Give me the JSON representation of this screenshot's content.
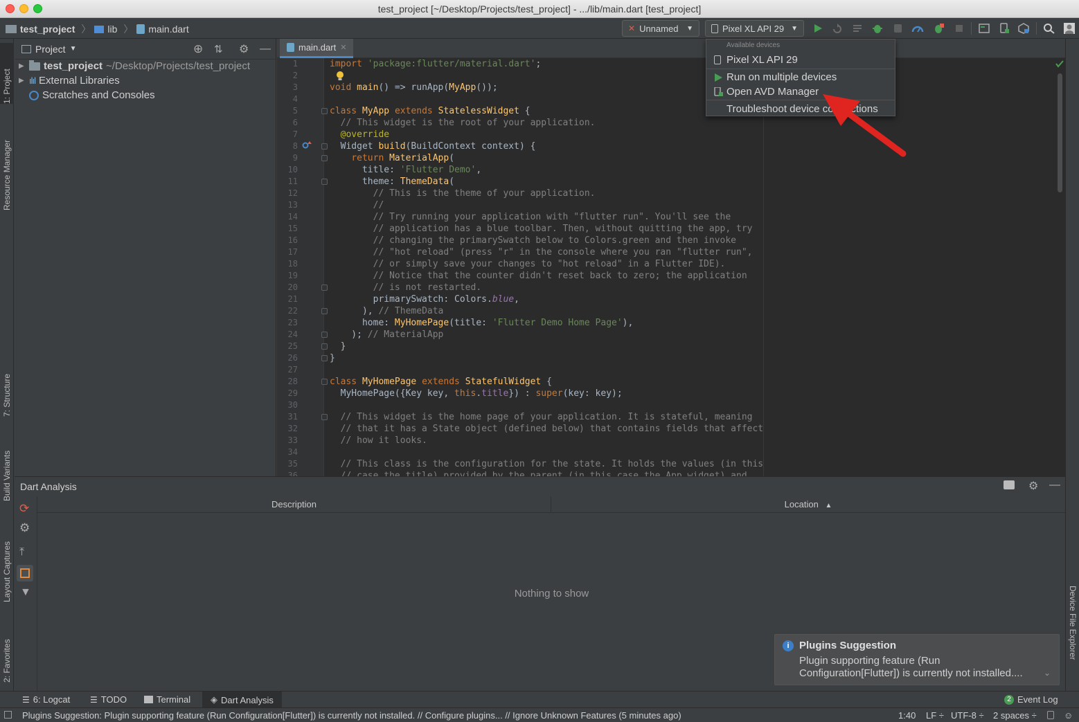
{
  "window": {
    "title": "test_project [~/Desktop/Projects/test_project] - .../lib/main.dart [test_project]"
  },
  "navbar": {
    "crumbs": [
      "test_project",
      "lib",
      "main.dart"
    ],
    "run_config": "Unnamed",
    "device": "Pixel XL API 29"
  },
  "sidebar_left": {
    "tabs": [
      "1: Project",
      "Resource Manager",
      "7: Structure",
      "Build Variants",
      "Layout Captures",
      "2: Favorites"
    ]
  },
  "sidebar_right": {
    "tabs": [
      "Device File Explorer"
    ]
  },
  "project_panel": {
    "title": "Project",
    "tree": [
      {
        "name": "test_project",
        "path": "~/Desktop/Projects/test_project"
      },
      {
        "name": "External Libraries"
      },
      {
        "name": "Scratches and Consoles"
      }
    ]
  },
  "editor": {
    "tab": "main.dart",
    "line_numbers": [
      "1",
      "2",
      "3",
      "4",
      "5",
      "6",
      "7",
      "8",
      "9",
      "10",
      "11",
      "12",
      "13",
      "14",
      "15",
      "16",
      "17",
      "18",
      "19",
      "20",
      "21",
      "22",
      "23",
      "24",
      "25",
      "26",
      "27",
      "28",
      "29",
      "30",
      "31",
      "32",
      "33",
      "34",
      "35",
      "36"
    ],
    "code": {
      "l1": [
        "import ",
        "'package:flutter/material.dart'",
        ";"
      ],
      "l3": [
        "void ",
        "main",
        "() => runApp(",
        "MyApp",
        "());"
      ],
      "l5": [
        "class ",
        "MyApp ",
        "extends ",
        "StatelessWidget",
        " {"
      ],
      "l6": "  // This widget is the root of your application.",
      "l7": "  @override",
      "l8": [
        "  Widget ",
        "build",
        "(BuildContext context) {"
      ],
      "l9": [
        "    ",
        "return ",
        "MaterialApp",
        "("
      ],
      "l10": [
        "      title: ",
        "'Flutter Demo'",
        ","
      ],
      "l11": [
        "      theme: ",
        "ThemeData",
        "("
      ],
      "l12": "        // This is the theme of your application.",
      "l13": "        //",
      "l14": "        // Try running your application with \"flutter run\". You'll see the",
      "l15": "        // application has a blue toolbar. Then, without quitting the app, try",
      "l16": "        // changing the primarySwatch below to Colors.green and then invoke",
      "l17": "        // \"hot reload\" (press \"r\" in the console where you ran \"flutter run\",",
      "l18": "        // or simply save your changes to \"hot reload\" in a Flutter IDE).",
      "l19": "        // Notice that the counter didn't reset back to zero; the application",
      "l20": "        // is not restarted.",
      "l21": [
        "        primarySwatch: Colors.",
        "blue",
        ","
      ],
      "l22": [
        "      ), ",
        "// ThemeData"
      ],
      "l23": [
        "      home: ",
        "MyHomePage",
        "(title: ",
        "'Flutter Demo Home Page'",
        "),"
      ],
      "l24": [
        "    ); ",
        "// MaterialApp"
      ],
      "l25": "  }",
      "l26": "}",
      "l28": [
        "class ",
        "MyHomePage ",
        "extends ",
        "StatefulWidget",
        " {"
      ],
      "l29": [
        "  MyHomePage({Key key, ",
        "this",
        ".",
        "title",
        "}) : ",
        "super",
        "(key: key);"
      ],
      "l31": "  // This widget is the home page of your application. It is stateful, meaning",
      "l32": "  // that it has a State object (defined below) that contains fields that affect",
      "l33": "  // how it looks.",
      "l35": "  // This class is the configuration for the state. It holds the values (in this",
      "l36": "  // case the title) provided by the parent (in this case the App widget) and"
    }
  },
  "device_menu": {
    "caption": "Available devices",
    "items": [
      "Pixel XL API 29",
      "Run on multiple devices",
      "Open AVD Manager",
      "Troubleshoot device connections"
    ]
  },
  "analysis": {
    "title": "Dart Analysis",
    "col_description": "Description",
    "col_location": "Location",
    "empty": "Nothing to show"
  },
  "notification": {
    "title": "Plugins Suggestion",
    "body_line1": "Plugin supporting feature (Run",
    "body_line2": "Configuration[Flutter]) is currently not installed...."
  },
  "tool_windows": {
    "logcat": "6: Logcat",
    "todo": "TODO",
    "terminal": "Terminal",
    "dart_analysis": "Dart Analysis",
    "event_log_count": "2",
    "event_log": "Event Log"
  },
  "status": {
    "message": "Plugins Suggestion: Plugin supporting feature (Run Configuration[Flutter]) is currently not installed. // Configure plugins... // Ignore Unknown Features (5 minutes ago)",
    "position": "1:40",
    "line_sep": "LF ÷",
    "encoding": "UTF-8 ÷",
    "indent": "2 spaces ÷"
  },
  "colors": {
    "accent": "#4a88c7",
    "run_green": "#499c54",
    "arrow_red": "#e0241f"
  }
}
